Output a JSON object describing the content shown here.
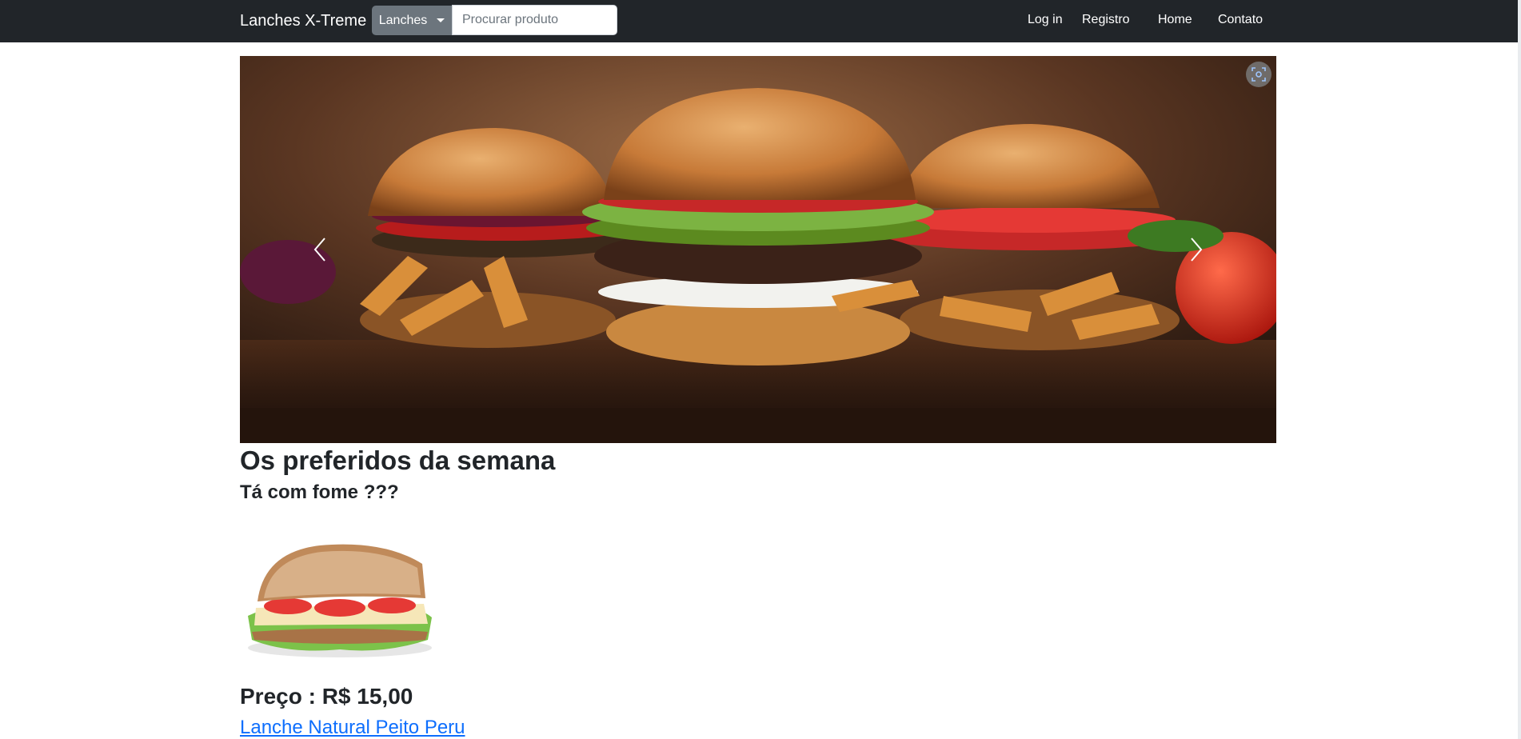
{
  "navbar": {
    "brand": "Lanches X-Treme",
    "dropdown_label": "Lanches",
    "search_placeholder": "Procurar produto",
    "links": {
      "login": "Log in",
      "register": "Registro",
      "home": "Home",
      "contact": "Contato"
    }
  },
  "carousel": {
    "prev_icon": "chevron-left-icon",
    "next_icon": "chevron-right-icon",
    "lens_icon": "visual-search-icon"
  },
  "main": {
    "title": "Os preferidos da semana",
    "subtitle": "Tá com fome ???",
    "product": {
      "price": "Preço : R$ 15,00",
      "name": "Lanche Natural Peito Peru"
    }
  },
  "colors": {
    "navbar_bg": "#212529",
    "dropdown_bg": "#6c757d",
    "link": "#0d6efd"
  }
}
